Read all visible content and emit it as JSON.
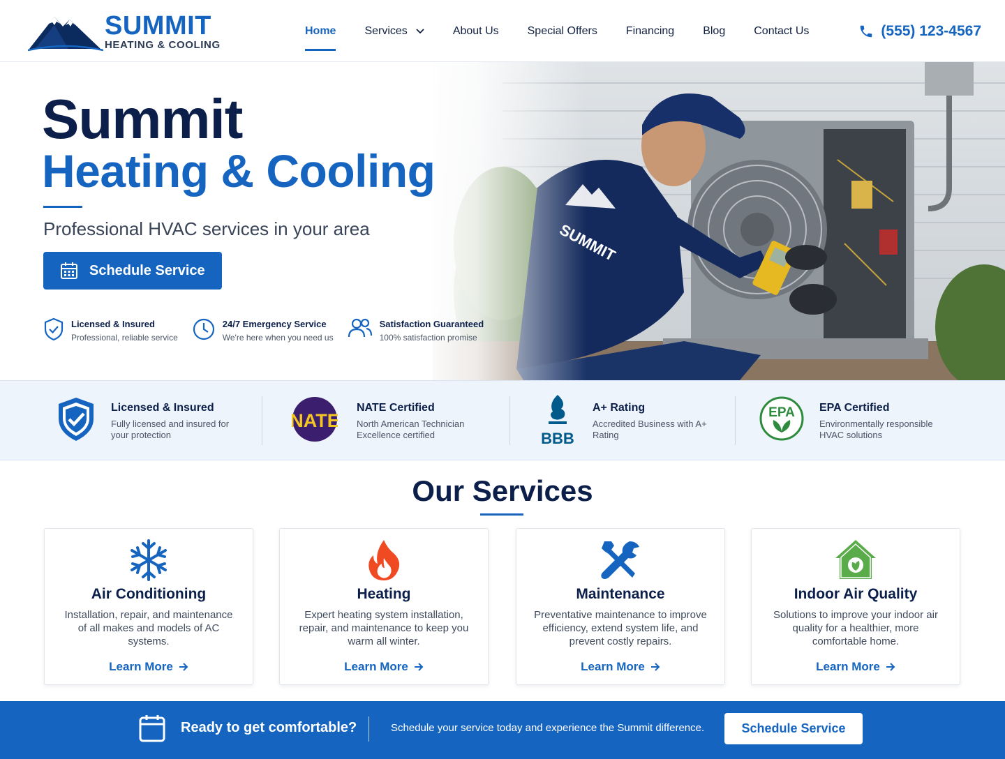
{
  "brand": {
    "name": "SUMMIT",
    "tagline": "HEATING & COOLING",
    "color_primary": "#1565c0",
    "color_dark": "#0b1f4a"
  },
  "nav": {
    "items": [
      {
        "label": "Home",
        "active": true
      },
      {
        "label": "Services",
        "dropdown": true
      },
      {
        "label": "About Us"
      },
      {
        "label": "Special Offers"
      },
      {
        "label": "Financing"
      },
      {
        "label": "Blog"
      },
      {
        "label": "Contact Us"
      }
    ],
    "phone": "(555) 123-4567"
  },
  "hero": {
    "title_line1": "Summit",
    "title_line2": "Heating & Cooling",
    "subtitle": "Professional HVAC services in your area",
    "cta_label": "Schedule Service",
    "photo_alt_icon": "technician-photo",
    "features": [
      {
        "icon": "shield-check-icon",
        "title": "Licensed & Insured",
        "desc": "Professional, reliable service"
      },
      {
        "icon": "clock-icon",
        "title": "24/7 Emergency Service",
        "desc": "We're here when you need us"
      },
      {
        "icon": "users-icon",
        "title": "Satisfaction Guaranteed",
        "desc": "100% satisfaction promise"
      }
    ]
  },
  "trust": [
    {
      "icon": "shield-badge-icon",
      "title": "Licensed & Insured",
      "desc": "Fully licensed and insured for your protection"
    },
    {
      "icon": "nate-logo",
      "badge_text": "NATE",
      "title": "NATE Certified",
      "desc": "North American Technician Excellence certified"
    },
    {
      "icon": "bbb-logo",
      "badge_text": "BBB",
      "title": "A+ Rating",
      "desc": "Accredited Business with A+ Rating"
    },
    {
      "icon": "epa-logo",
      "badge_text": "EPA",
      "title": "EPA Certified",
      "desc": "Environmentally responsible HVAC solutions"
    }
  ],
  "services": {
    "heading": "Our Services",
    "cards": [
      {
        "icon": "snowflake-icon",
        "title": "Air Conditioning",
        "desc": "Installation, repair, and maintenance of all makes and models of AC systems.",
        "link": "Learn More"
      },
      {
        "icon": "flame-icon",
        "title": "Heating",
        "desc": "Expert heating system installation, repair, and maintenance to keep you warm all winter.",
        "link": "Learn More"
      },
      {
        "icon": "tools-icon",
        "title": "Maintenance",
        "desc": "Preventative maintenance to improve efficiency, extend system life, and prevent costly repairs.",
        "link": "Learn More"
      },
      {
        "icon": "house-leaf-icon",
        "title": "Indoor Air Quality",
        "desc": "Solutions to improve your indoor air quality for a healthier, more comfortable home.",
        "link": "Learn More"
      }
    ]
  },
  "cta_bar": {
    "heading": "Ready to get comfortable?",
    "text": "Schedule your service today and experience the Summit difference.",
    "button": "Schedule Service"
  }
}
